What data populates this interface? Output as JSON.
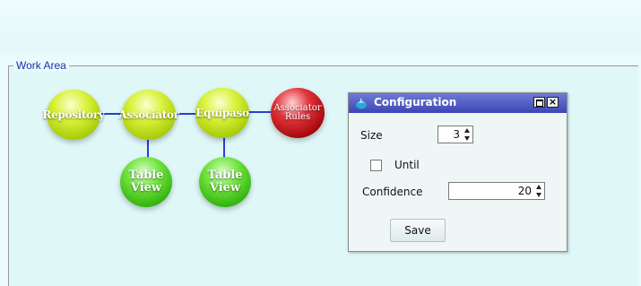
{
  "work_area": {
    "title": "Work Area"
  },
  "nodes": {
    "repository": {
      "label": "Repository",
      "color": "#c8e61e"
    },
    "associator": {
      "label": "Associator",
      "color": "#c8e61e"
    },
    "equipaso": {
      "label": "Equipaso",
      "color": "#c8e61e"
    },
    "associator_rules": {
      "line1": "Associator",
      "line2": "Rules",
      "color": "#b0151a"
    },
    "table_view_1": {
      "line1": "Table",
      "line2": "View",
      "color": "#3cc41a"
    },
    "table_view_2": {
      "line1": "Table",
      "line2": "View",
      "color": "#3cc41a"
    }
  },
  "connector_color": "#2c3fcf",
  "dialog": {
    "title": "Configuration",
    "title_icon": "java-cup-icon",
    "maximize_icon": "maximize-icon",
    "close_label": "×",
    "size_label": "Size",
    "size_value": "3",
    "until_label": "Until",
    "until_checked": false,
    "confidence_label": "Confidence",
    "confidence_value": "20",
    "save_label": "Save",
    "titlebar_color": "#4a55c2"
  }
}
